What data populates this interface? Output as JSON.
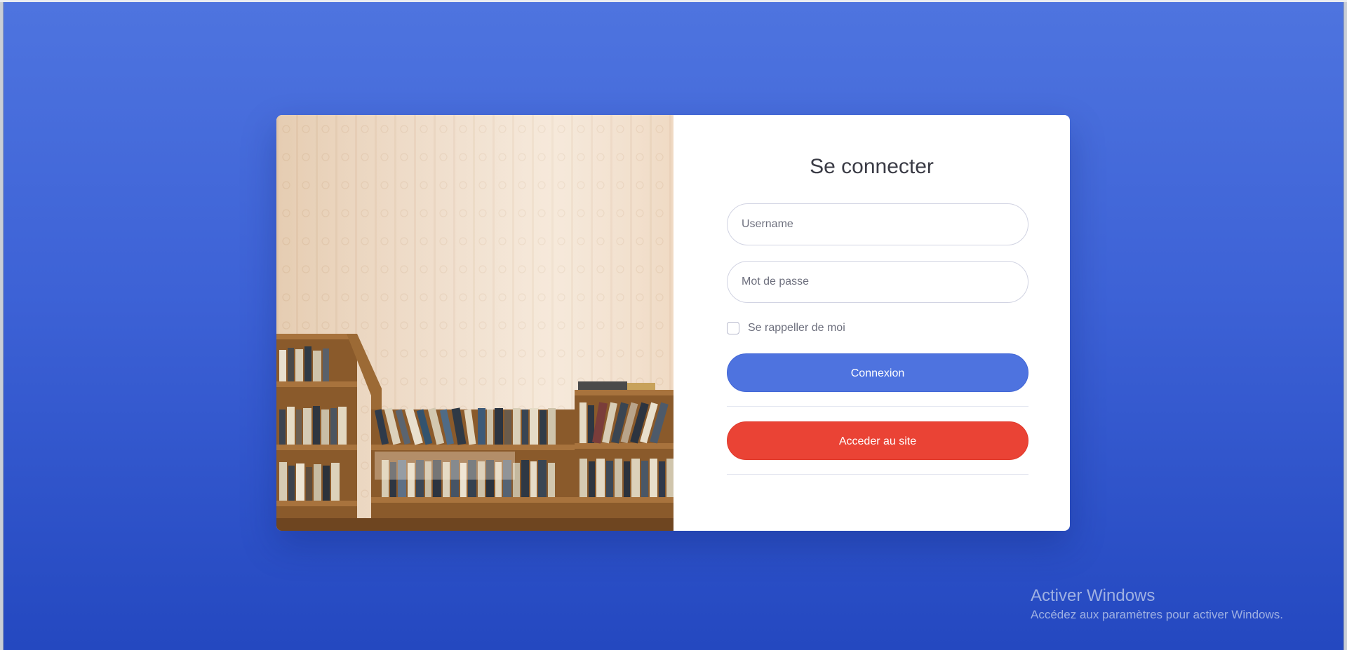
{
  "login": {
    "title": "Se connecter",
    "username_placeholder": "Username",
    "password_placeholder": "Mot de passe",
    "remember_label": "Se rappeller de moi",
    "submit_label": "Connexion",
    "site_label": "Acceder au site"
  },
  "watermark": {
    "title": "Activer Windows",
    "subtitle": "Accédez aux paramètres pour activer Windows."
  },
  "colors": {
    "background_top": "#4e74df",
    "background_bottom": "#2448c0",
    "primary_button": "#4e73df",
    "danger_button": "#ea4335",
    "title_text": "#3a3b45",
    "muted_text": "#6e707e"
  },
  "image": {
    "description_icon": "bookshelf-photo"
  }
}
